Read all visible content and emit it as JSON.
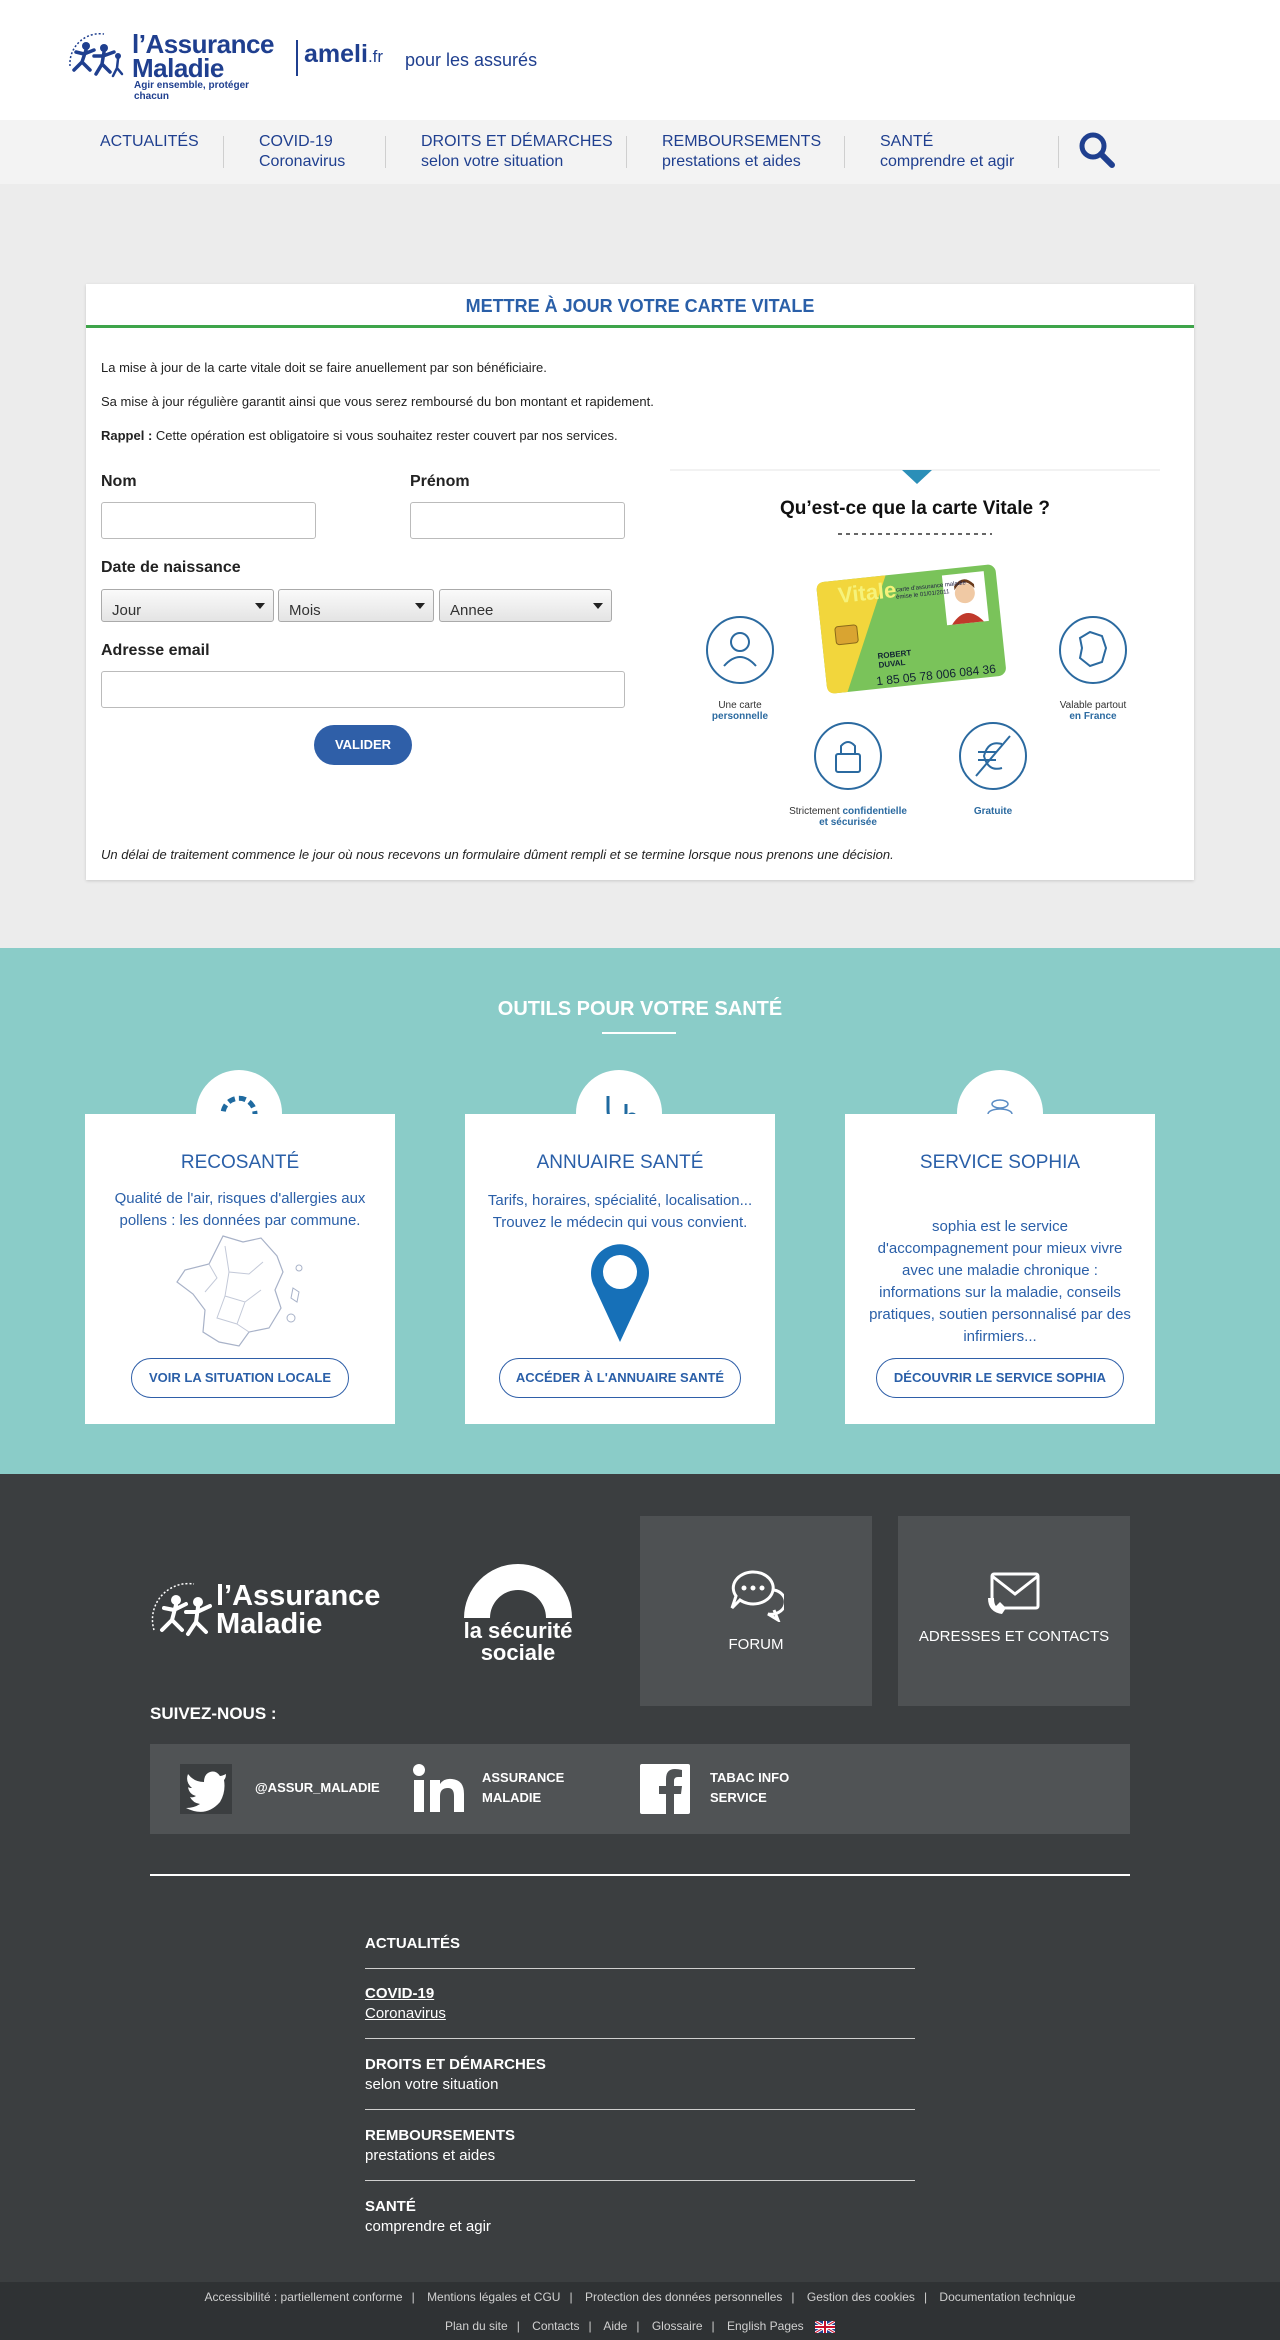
{
  "header": {
    "logo_title_line1": "l’Assurance",
    "logo_title_line2": "Maladie",
    "logo_tagline": "Agir ensemble, protéger chacun",
    "ameli": "ameli",
    "ameli_tld": ".fr",
    "audience": "pour les assurés"
  },
  "nav": [
    {
      "line1": "ACTUALITÉS",
      "line2": ""
    },
    {
      "line1": "COVID-19",
      "line2": "Coronavirus"
    },
    {
      "line1": "DROITS ET DÉMARCHES",
      "line2": "selon votre situation"
    },
    {
      "line1": "REMBOURSEMENTS",
      "line2": "prestations et aides"
    },
    {
      "line1": "SANTÉ",
      "line2": "comprendre et agir"
    }
  ],
  "form": {
    "title": "METTRE À JOUR VOTRE CARTE VITALE",
    "para1": "La mise à jour de la carte vitale doit se faire anuellement par son bénéficiaire.",
    "para2": "Sa mise à jour régulière garantit ainsi que vous serez remboursé du bon montant et rapidement.",
    "rappel_label": "Rappel :",
    "rappel_text": " Cette opération est obligatoire si vous souhaitez rester couvert par nos services.",
    "nom_label": "Nom",
    "prenom_label": "Prénom",
    "dob_label": "Date de naissance",
    "day_value": "Jour",
    "month_value": "Mois",
    "year_value": "Annee",
    "email_label": "Adresse email",
    "submit": "VALIDER",
    "note": "Un délai de traitement commence le jour où nous recevons un formulaire dûment rempli et se termine lorsque nous prenons une décision."
  },
  "vitale_info": {
    "title": "Qu’est-ce que la carte Vitale ?",
    "card_brand": "Vitale",
    "card_sub": "carte d’assurance maladie",
    "card_date": "émise le 01/01/2011",
    "card_name1": "ROBERT",
    "card_name2": "DUVAL",
    "card_number": "1 85 05 78 006 084 36",
    "feature1_a": "Une carte",
    "feature1_b": "personnelle",
    "feature2_a": "Valable partout",
    "feature2_b": "en France",
    "feature3_a": "Strictement",
    "feature3_b": "confidentielle",
    "feature3_c": "et sécurisée",
    "feature4": "Gratuite"
  },
  "tools": {
    "title": "OUTILS POUR VOTRE SANTÉ",
    "cards": [
      {
        "name": "RECOSANTÉ",
        "desc": "Qualité de l'air, risques d'allergies aux pollens : les données par commune.",
        "button": "VOIR LA SITUATION LOCALE"
      },
      {
        "name": "ANNUAIRE SANTÉ",
        "desc": "Tarifs, horaires, spécialité, localisation... Trouvez le médecin qui vous convient.",
        "button": "ACCÉDER À L'ANNUAIRE SANTÉ"
      },
      {
        "name": "SERVICE SOPHIA",
        "desc": "sophia est le service d'accompagnement pour mieux vivre avec une maladie chronique : informations sur la maladie, conseils pratiques, soutien personnalisé par des infirmiers...",
        "button": "DÉCOUVRIR LE SERVICE SOPHIA"
      }
    ]
  },
  "footer": {
    "logo_line1": "l’Assurance",
    "logo_line2": "Maladie",
    "secu_line1": "la sécurité",
    "secu_line2": "sociale",
    "forum": "FORUM",
    "contacts": "ADRESSES ET CONTACTS",
    "follow": "SUIVEZ-NOUS :",
    "twitter": "@ASSUR_MALADIE",
    "linkedin_1": "ASSURANCE",
    "linkedin_2": "MALADIE",
    "facebook_1": "TABAC INFO",
    "facebook_2": "SERVICE",
    "nav": [
      {
        "line1": "ACTUALITÉS",
        "line2": ""
      },
      {
        "line1": "COVID-19",
        "line2": "Coronavirus"
      },
      {
        "line1": "DROITS ET DÉMARCHES",
        "line2": "selon votre situation"
      },
      {
        "line1": "REMBOURSEMENTS",
        "line2": "prestations et aides"
      },
      {
        "line1": "SANTÉ",
        "line2": "comprendre et agir"
      }
    ],
    "links_row1": [
      "Accessibilité : partiellement conforme",
      "Mentions légales et CGU",
      "Protection des données personnelles",
      "Gestion des cookies",
      "Documentation technique"
    ],
    "links_row2": [
      "Plan du site",
      "Contacts",
      "Aide",
      "Glossaire",
      "English Pages"
    ]
  },
  "colors": {
    "brand_blue": "#1f3f8f",
    "link_blue": "#2a5fa8",
    "green": "#3ea44a",
    "teal": "#8accc8",
    "footer": "#3b3e40"
  }
}
